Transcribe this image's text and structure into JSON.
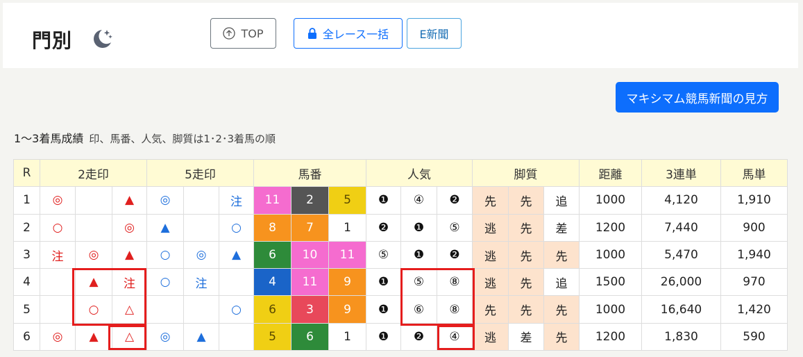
{
  "header": {
    "title": "門別",
    "buttons": {
      "top": "TOP",
      "all_races": "全レース一括",
      "enewspaper": "E新聞"
    }
  },
  "guide_button": "マキシマム競馬新聞の見方",
  "caption": {
    "main": "1〜3着馬成績",
    "sub": "印、馬番、人気、脚質は1･2･3着馬の順"
  },
  "table": {
    "headers": {
      "r": "R",
      "mark2": "2走印",
      "mark5": "5走印",
      "umaban": "馬番",
      "ninki": "人気",
      "kyakushitsu": "脚質",
      "kyori": "距離",
      "sanrentan": "3連単",
      "umatan": "馬単"
    },
    "rows": [
      {
        "r": "1",
        "m2": [
          "◎",
          "",
          "▲"
        ],
        "m5": [
          "◎",
          "",
          "注"
        ],
        "umaban": [
          "11",
          "2",
          "5"
        ],
        "ninki": [
          "❶",
          "④",
          "❷"
        ],
        "style": [
          "先",
          "先",
          "追"
        ],
        "dist": "1000",
        "sanrentan": "4,120",
        "umatan": "1,910"
      },
      {
        "r": "2",
        "m2": [
          "○",
          "",
          "◎"
        ],
        "m5": [
          "▲",
          "",
          "○"
        ],
        "umaban": [
          "8",
          "7",
          "1"
        ],
        "ninki": [
          "❷",
          "❶",
          "⑤"
        ],
        "style": [
          "逃",
          "先",
          "差"
        ],
        "dist": "1200",
        "sanrentan": "7,440",
        "umatan": "900"
      },
      {
        "r": "3",
        "m2": [
          "注",
          "◎",
          "▲"
        ],
        "m5": [
          "○",
          "◎",
          "▲"
        ],
        "umaban": [
          "6",
          "10",
          "11"
        ],
        "ninki": [
          "⑤",
          "❶",
          "❷"
        ],
        "style": [
          "逃",
          "先",
          "先"
        ],
        "dist": "1000",
        "sanrentan": "5,470",
        "umatan": "1,940"
      },
      {
        "r": "4",
        "m2": [
          "",
          "▲",
          "注"
        ],
        "m5": [
          "○",
          "注",
          ""
        ],
        "umaban": [
          "4",
          "11",
          "9"
        ],
        "ninki": [
          "❶",
          "⑤",
          "⑧"
        ],
        "style": [
          "逃",
          "先",
          "追"
        ],
        "dist": "1500",
        "sanrentan": "26,000",
        "umatan": "970"
      },
      {
        "r": "5",
        "m2": [
          "",
          "○",
          "△"
        ],
        "m5": [
          "",
          "",
          "○"
        ],
        "umaban": [
          "6",
          "3",
          "9"
        ],
        "ninki": [
          "❶",
          "⑥",
          "⑧"
        ],
        "style": [
          "先",
          "先",
          "先"
        ],
        "dist": "1000",
        "sanrentan": "16,640",
        "umatan": "1,420"
      },
      {
        "r": "6",
        "m2": [
          "◎",
          "▲",
          "△"
        ],
        "m5": [
          "◎",
          "▲",
          ""
        ],
        "umaban": [
          "5",
          "6",
          "1"
        ],
        "ninki": [
          "❶",
          "❷",
          "④"
        ],
        "style": [
          "逃",
          "差",
          "先"
        ],
        "dist": "1200",
        "sanrentan": "1,830",
        "umatan": "590"
      }
    ]
  },
  "colors": {
    "frame_1": "#ffffff",
    "frame_2": "#555555",
    "frame_3": "#e8352e",
    "frame_4": "#1a64c8",
    "frame_5": "#f0cf14",
    "frame_6": "#2e8b3a",
    "frame_7": "#f7931e",
    "frame_8": "#f56ccf",
    "highlight": "#e51d1d",
    "accent": "#0d6efd"
  }
}
